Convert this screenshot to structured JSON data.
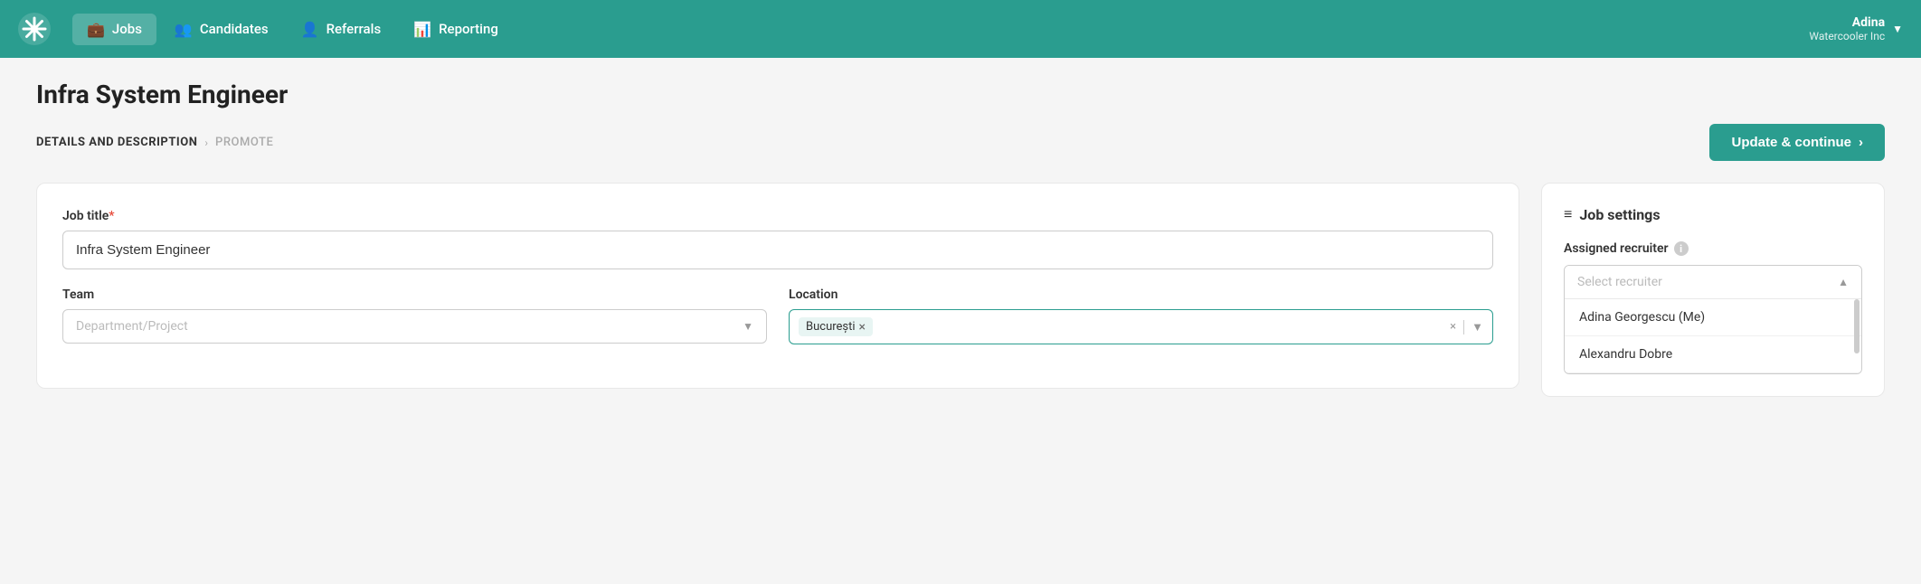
{
  "navbar": {
    "logo_label": "Workable",
    "items": [
      {
        "id": "jobs",
        "label": "Jobs",
        "icon": "💼",
        "active": true
      },
      {
        "id": "candidates",
        "label": "Candidates",
        "icon": "👥",
        "active": false
      },
      {
        "id": "referrals",
        "label": "Referrals",
        "icon": "👤",
        "active": false
      },
      {
        "id": "reporting",
        "label": "Reporting",
        "icon": "📊",
        "active": false
      }
    ],
    "user": {
      "name": "Adina",
      "company": "Watercooler Inc"
    }
  },
  "page": {
    "title": "Infra System Engineer",
    "breadcrumbs": [
      {
        "label": "DETAILS AND DESCRIPTION",
        "active": true
      },
      {
        "label": "PROMOTE",
        "active": false
      }
    ],
    "update_button": "Update & continue"
  },
  "form": {
    "job_title_label": "Job title",
    "job_title_required": "*",
    "job_title_value": "Infra System Engineer",
    "team_label": "Team",
    "team_placeholder": "Department/Project",
    "location_label": "Location",
    "location_value": "București",
    "location_placeholder": ""
  },
  "settings": {
    "title": "Job settings",
    "title_icon": "⚙",
    "recruiter_label": "Assigned recruiter",
    "recruiter_placeholder": "Select recruiter",
    "recruiter_options": [
      {
        "id": "adina",
        "label": "Adina Georgescu (Me)"
      },
      {
        "id": "alex",
        "label": "Alexandru Dobre"
      }
    ]
  }
}
